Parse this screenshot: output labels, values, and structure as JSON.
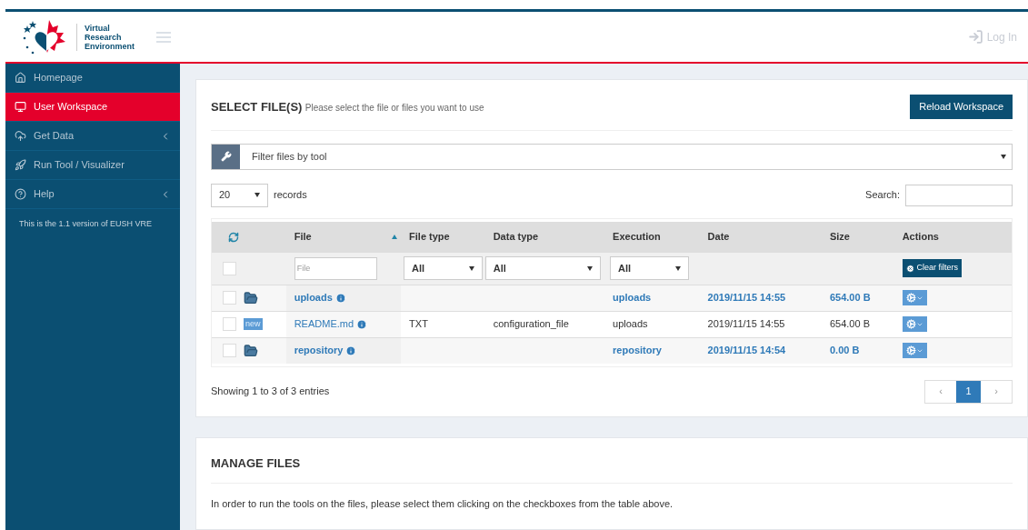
{
  "header": {
    "logo_text": [
      "Virtual",
      "Research",
      "Environment"
    ],
    "login": "Log In"
  },
  "sidebar": {
    "items": [
      {
        "label": "Homepage",
        "selected": false,
        "has_submenu": false
      },
      {
        "label": "User Workspace",
        "selected": true,
        "has_submenu": false
      },
      {
        "label": "Get Data",
        "selected": false,
        "has_submenu": true
      },
      {
        "label": "Run Tool / Visualizer",
        "selected": false,
        "has_submenu": false
      },
      {
        "label": "Help",
        "selected": false,
        "has_submenu": true
      }
    ],
    "version_note": "This is the 1.1 version of EUSH VRE"
  },
  "select_panel": {
    "title": "SELECT FILE(S)",
    "subtitle": "Please select the file or files you want to use",
    "reload_button": "Reload Workspace",
    "tool_filter": {
      "value": "Filter files by tool"
    },
    "records": {
      "value": "20",
      "label": "records"
    },
    "search": {
      "label": "Search:"
    },
    "table": {
      "columns": [
        {
          "label": "File",
          "sorted": true
        },
        {
          "label": "File type",
          "sorted": false
        },
        {
          "label": "Data type",
          "sorted": false
        },
        {
          "label": "Execution",
          "sorted": false
        },
        {
          "label": "Date",
          "sorted": false
        },
        {
          "label": "Size",
          "sorted": false
        },
        {
          "label": "Actions",
          "sorted": false
        }
      ],
      "filters": {
        "select_all_checked": false,
        "file_placeholder": "File",
        "file_type": "All",
        "data_type": "All",
        "execution": "All",
        "clear_button": "Clear filters"
      },
      "rows": [
        {
          "kind": "folder",
          "checked": false,
          "file": "uploads",
          "execution": "uploads",
          "date": "2019/11/15 14:55",
          "size": "654.00 B"
        },
        {
          "kind": "file",
          "checked": false,
          "badge": "new",
          "file": "README.md",
          "file_type": "TXT",
          "data_type": "configuration_file",
          "execution": "uploads",
          "date": "2019/11/15 14:55",
          "size": "654.00 B"
        },
        {
          "kind": "folder",
          "checked": false,
          "file": "repository",
          "execution": "repository",
          "date": "2019/11/15 14:54",
          "size": "0.00 B"
        }
      ]
    },
    "info": "Showing 1 to 3 of 3 entries",
    "pagination": {
      "prev": "‹",
      "pages": [
        {
          "label": "1",
          "selected": true
        }
      ],
      "next": "›"
    }
  },
  "manage_panel": {
    "title": "MANAGE FILES",
    "text": "In order to run the tools on the files, please select them clicking on the checkboxes from the table above."
  }
}
